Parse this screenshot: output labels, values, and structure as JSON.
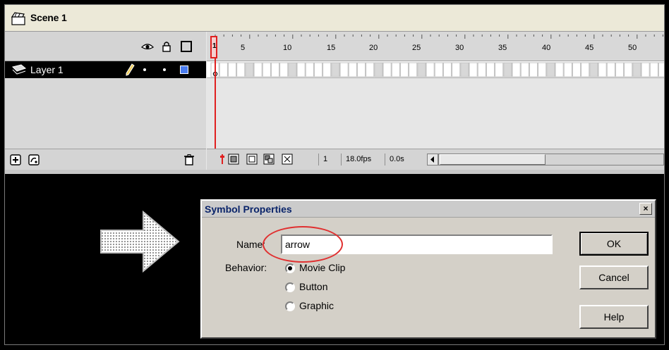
{
  "scene": {
    "label": "Scene 1",
    "icon": "scene-clapper-icon"
  },
  "timeline": {
    "header_icons": [
      "eye-icon",
      "lock-icon",
      "outline-icon"
    ],
    "layer": {
      "name": "Layer 1",
      "color": "#4a7cf0"
    },
    "ruler_labels": [
      "1",
      "5",
      "10",
      "15",
      "20",
      "25",
      "30",
      "35",
      "40",
      "45",
      "50"
    ],
    "current_frame": "1",
    "frame_rate": "18.0fps",
    "elapsed_time": "0.0s"
  },
  "dialog": {
    "title": "Symbol Properties",
    "close_label": "×",
    "name_label": "Name:",
    "name_value": "arrow",
    "behavior_label": "Behavior:",
    "behaviors": [
      {
        "label": "Movie Clip",
        "selected": true
      },
      {
        "label": "Button",
        "selected": false
      },
      {
        "label": "Graphic",
        "selected": false
      }
    ],
    "ok_label": "OK",
    "cancel_label": "Cancel",
    "help_label": "Help"
  },
  "colors": {
    "playhead": "#e02020",
    "highlight_circle": "#e03030",
    "title_text": "#0a246a"
  }
}
